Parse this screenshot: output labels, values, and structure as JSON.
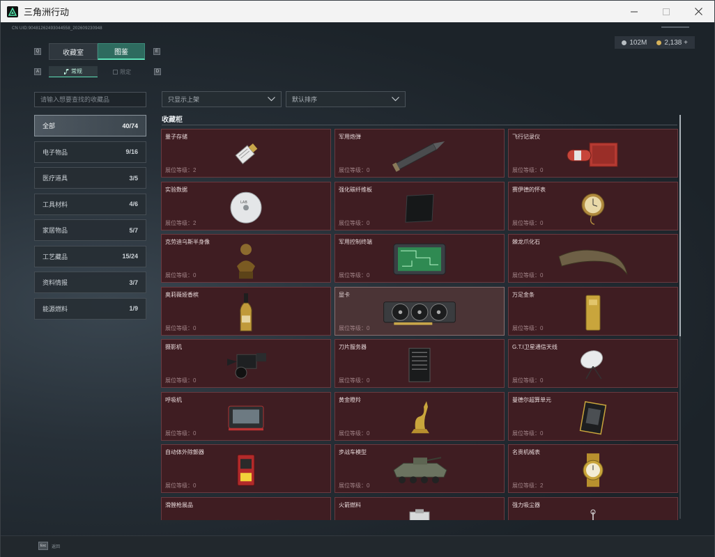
{
  "window": {
    "title": "三角洲行动"
  },
  "hud": {
    "uid": "CN UID:9048126249304455​8_202609230948",
    "currency_a": "102M",
    "currency_b": "2,138 +"
  },
  "tabs": {
    "collection_room": "收藏室",
    "catalog": "图鉴"
  },
  "subtabs": {
    "normal": "常规",
    "limited": "限定"
  },
  "search": {
    "placeholder": "请输入想要查找的收藏品"
  },
  "filters": {
    "shelf": "只显示上架",
    "sort": "默认排序"
  },
  "section_title": "收藏柜",
  "categories": [
    {
      "label": "全部",
      "count": "40/74"
    },
    {
      "label": "电子物品",
      "count": "9/16"
    },
    {
      "label": "医疗道具",
      "count": "3/5"
    },
    {
      "label": "工具材料",
      "count": "4/6"
    },
    {
      "label": "家居物品",
      "count": "5/7"
    },
    {
      "label": "工艺藏品",
      "count": "15/24"
    },
    {
      "label": "资料情报",
      "count": "3/7"
    },
    {
      "label": "能源燃料",
      "count": "1/9"
    }
  ],
  "level_label": "展位等级：",
  "items": [
    {
      "name": "量子存储",
      "level": "2",
      "icon": "usb-drive-icon"
    },
    {
      "name": "军用炮弹",
      "level": "0",
      "icon": "artillery-shell-icon"
    },
    {
      "name": "飞行记录仪",
      "level": "0",
      "icon": "flight-recorder-icon"
    },
    {
      "name": "实验数据",
      "level": "2",
      "icon": "data-disc-icon"
    },
    {
      "name": "强化碳纤维板",
      "level": "0",
      "icon": "carbon-plate-icon"
    },
    {
      "name": "赛伊德的怀表",
      "level": "0",
      "icon": "pocket-watch-icon"
    },
    {
      "name": "克劳迪乌斯半身像",
      "level": "0",
      "icon": "bust-statue-icon"
    },
    {
      "name": "军用控制终端",
      "level": "0",
      "icon": "control-terminal-icon"
    },
    {
      "name": "棘龙爪化石",
      "level": "0",
      "icon": "claw-fossil-icon"
    },
    {
      "name": "奥莉薇娅香槟",
      "level": "0",
      "icon": "champagne-icon"
    },
    {
      "name": "显卡",
      "level": "0",
      "icon": "graphics-card-icon"
    },
    {
      "name": "万足金条",
      "level": "0",
      "icon": "gold-bar-icon"
    },
    {
      "name": "摄影机",
      "level": "0",
      "icon": "camera-icon"
    },
    {
      "name": "刀片服务器",
      "level": "0",
      "icon": "blade-server-icon"
    },
    {
      "name": "G.T.I卫星通信天线",
      "level": "0",
      "icon": "satellite-dish-icon"
    },
    {
      "name": "呼吸机",
      "level": "0",
      "icon": "ventilator-icon"
    },
    {
      "name": "黄金瞪羚",
      "level": "0",
      "icon": "gold-gazelle-icon"
    },
    {
      "name": "曼德尔超算单元",
      "level": "0",
      "icon": "compute-unit-icon"
    },
    {
      "name": "自动体外除颤器",
      "level": "0",
      "icon": "defibrillator-icon"
    },
    {
      "name": "步战车模型",
      "level": "0",
      "icon": "ifv-model-icon"
    },
    {
      "name": "名贵机械表",
      "level": "2",
      "icon": "wristwatch-icon"
    },
    {
      "name": "滑膛枪展品",
      "level": "",
      "icon": "musket-icon"
    },
    {
      "name": "火箭燃料",
      "level": "",
      "icon": "fuel-can-icon"
    },
    {
      "name": "强力吸尘器",
      "level": "",
      "icon": "vacuum-icon"
    }
  ],
  "footer": {
    "esc_key": "Esc",
    "back_label": "返回"
  },
  "colors": {
    "accent": "#5fe3b9",
    "card_bg": "#3f1d22",
    "card_highlight": "#4b3436"
  }
}
